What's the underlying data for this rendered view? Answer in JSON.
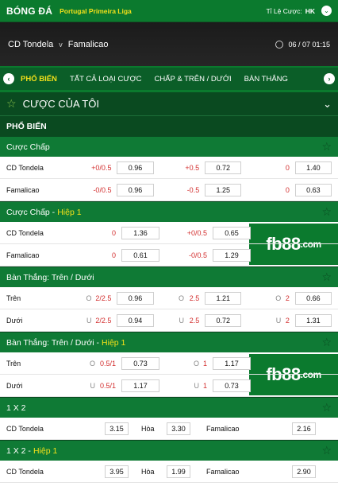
{
  "topbar": {
    "brand": "BÓNG ĐÁ",
    "league": "Portugal Primeira Liga",
    "odds_label": "Tỉ Lệ Cược:",
    "odds_value": "HK"
  },
  "match": {
    "home": "CD Tondela",
    "vs": "v",
    "away": "Famalicao",
    "datetime": "06 / 07  01:15"
  },
  "tabs": [
    "PHỔ BIẾN",
    "TẤT CẢ LOẠI CƯỢC",
    "CHẤP & TRÊN / DƯỚI",
    "BÀN THẮNG"
  ],
  "mybets": "CƯỢC CỦA TÔI",
  "popular": "PHỔ BIẾN",
  "banner": {
    "main": "fb88",
    ".com": ".com"
  },
  "s1": {
    "title": "Cược Chấp",
    "rows": [
      {
        "team": "CD Tondela",
        "h1": "+0/0.5",
        "o1": "0.96",
        "h2": "+0.5",
        "o2": "0.72",
        "h3": "0",
        "o3": "1.40"
      },
      {
        "team": "Famalicao",
        "h1": "-0/0.5",
        "o1": "0.96",
        "h2": "-0.5",
        "o2": "1.25",
        "h3": "0",
        "o3": "0.63"
      }
    ]
  },
  "s2": {
    "title": "Cược Chấp -",
    "hl": "Hiệp 1",
    "rows": [
      {
        "team": "CD Tondela",
        "h1": "0",
        "o1": "1.36",
        "h2": "+0/0.5",
        "o2": "0.65"
      },
      {
        "team": "Famalicao",
        "h1": "0",
        "o1": "0.61",
        "h2": "-0/0.5",
        "o2": "1.29"
      }
    ]
  },
  "s3": {
    "title": "Bàn Thắng: Trên / Dưới",
    "rows": [
      {
        "team": "Trên",
        "p1": "O",
        "h1": "2/2.5",
        "o1": "0.96",
        "p2": "O",
        "h2": "2.5",
        "o2": "1.21",
        "p3": "O",
        "h3": "2",
        "o3": "0.66"
      },
      {
        "team": "Dưới",
        "p1": "U",
        "h1": "2/2.5",
        "o1": "0.94",
        "p2": "U",
        "h2": "2.5",
        "o2": "0.72",
        "p3": "U",
        "h3": "2",
        "o3": "1.31"
      }
    ]
  },
  "s4": {
    "title": "Bàn Thắng: Trên / Dưới -",
    "hl": "Hiệp 1",
    "rows": [
      {
        "team": "Trên",
        "p1": "O",
        "h1": "0.5/1",
        "o1": "0.73",
        "p2": "O",
        "h2": "1",
        "o2": "1.17"
      },
      {
        "team": "Dưới",
        "p1": "U",
        "h1": "0.5/1",
        "o1": "1.17",
        "p2": "U",
        "h2": "1",
        "o2": "0.73"
      }
    ]
  },
  "s5": {
    "title": "1 X 2",
    "home": "CD Tondela",
    "o1": "3.15",
    "draw": "Hòa",
    "ox": "3.30",
    "away": "Famalicao",
    "o2": "2.16"
  },
  "s6": {
    "title": "1 X 2 -",
    "hl": "Hiệp 1",
    "home": "CD Tondela",
    "o1": "3.95",
    "draw": "Hòa",
    "ox": "1.99",
    "away": "Famalicao",
    "o2": "2.90"
  }
}
